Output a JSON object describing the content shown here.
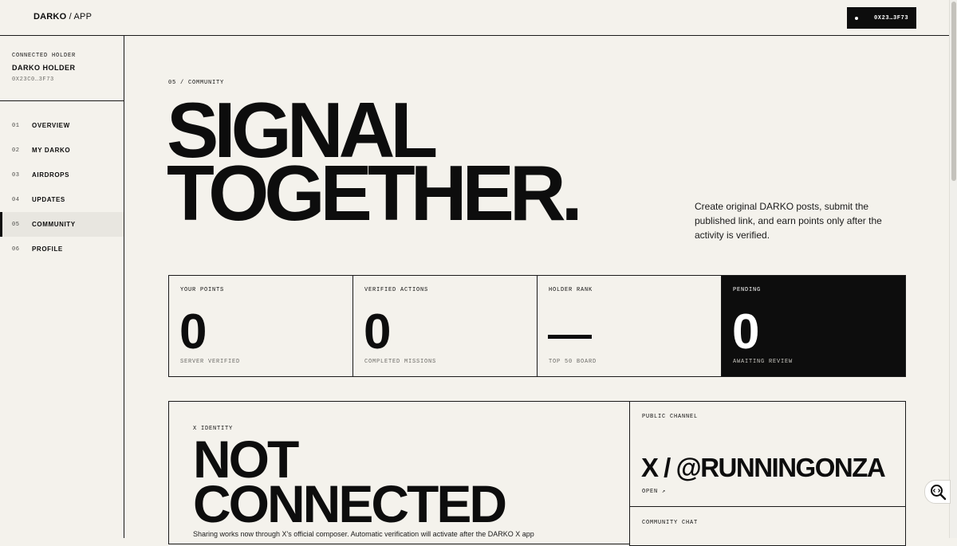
{
  "brand": {
    "main": "DARKO",
    "sep": " / ",
    "sub": "APP"
  },
  "wallet": {
    "label": "0X23…3F73"
  },
  "holder": {
    "eyebrow": "CONNECTED HOLDER",
    "name": "DARKO HOLDER",
    "address": "0X23C0…3F73"
  },
  "nav": {
    "items": [
      {
        "num": "01",
        "label": "OVERVIEW"
      },
      {
        "num": "02",
        "label": "MY DARKO"
      },
      {
        "num": "03",
        "label": "AIRDROPS"
      },
      {
        "num": "04",
        "label": "UPDATES"
      },
      {
        "num": "05",
        "label": "COMMUNITY"
      },
      {
        "num": "06",
        "label": "PROFILE"
      }
    ],
    "active": "COMMUNITY"
  },
  "page": {
    "section": "05 / COMMUNITY",
    "hero_line1": "SIGNAL",
    "hero_line2": "TOGETHER.",
    "description": "Create original DARKO posts, submit the published link, and earn points only after the activity is verified."
  },
  "stats": [
    {
      "label": "YOUR POINTS",
      "value": "0",
      "sub": "SERVER VERIFIED"
    },
    {
      "label": "VERIFIED ACTIONS",
      "value": "0",
      "sub": "COMPLETED MISSIONS"
    },
    {
      "label": "HOLDER RANK",
      "value": "—",
      "sub": "TOP 50 BOARD"
    },
    {
      "label": "PENDING",
      "value": "0",
      "sub": "AWAITING REVIEW"
    }
  ],
  "identity": {
    "label": "X IDENTITY",
    "title_line1": "NOT",
    "title_line2": "CONNECTED",
    "description": "Sharing works now through X's official composer. Automatic verification will activate after the DARKO X app"
  },
  "channel": {
    "label": "PUBLIC CHANNEL",
    "handle": "X / @RUNNINGONZA",
    "open": "OPEN ↗"
  },
  "chat": {
    "label": "COMMUNITY CHAT"
  }
}
